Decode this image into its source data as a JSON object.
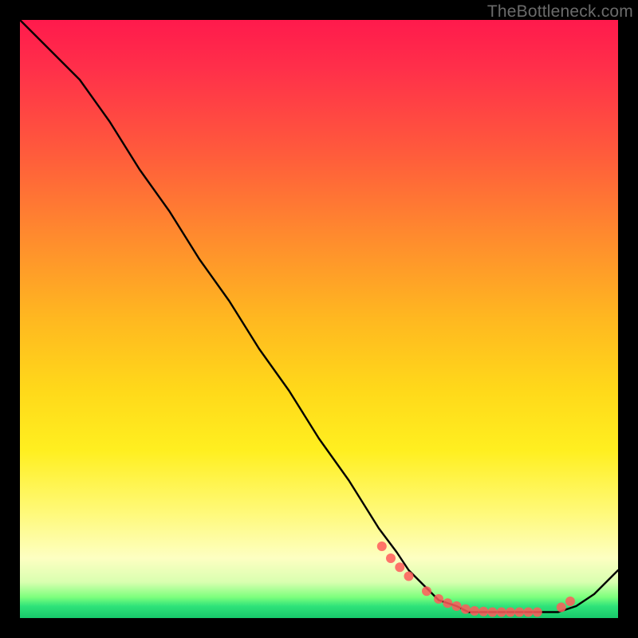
{
  "watermark": "TheBottleneck.com",
  "chart_data": {
    "type": "line",
    "title": "",
    "xlabel": "",
    "ylabel": "",
    "xlim": [
      0,
      100
    ],
    "ylim": [
      0,
      100
    ],
    "grid": false,
    "legend": false,
    "background_gradient": {
      "stops": [
        {
          "pos": 0,
          "color": "#ff1a4c"
        },
        {
          "pos": 50,
          "color": "#ffd91a"
        },
        {
          "pos": 90,
          "color": "#fdffc2"
        },
        {
          "pos": 100,
          "color": "#17c96b"
        }
      ]
    },
    "series": [
      {
        "name": "bottleneck-curve",
        "color": "#000000",
        "x": [
          0,
          3,
          6,
          10,
          15,
          20,
          25,
          30,
          35,
          40,
          45,
          50,
          55,
          60,
          63,
          65,
          68,
          70,
          73,
          75,
          78,
          80,
          82,
          84,
          86,
          88,
          90,
          93,
          96,
          100
        ],
        "y": [
          100,
          97,
          94,
          90,
          83,
          75,
          68,
          60,
          53,
          45,
          38,
          30,
          23,
          15,
          11,
          8,
          5,
          3,
          2,
          1,
          1,
          1,
          1,
          1,
          1,
          1,
          1,
          2,
          4,
          8
        ]
      }
    ],
    "markers": {
      "name": "highlight-dots",
      "color": "#ff5a5a",
      "radius_px": 6,
      "x": [
        60.5,
        62,
        63.5,
        65,
        68,
        70,
        71.5,
        73,
        74.5,
        76,
        77.5,
        79,
        80.5,
        82,
        83.5,
        85,
        86.5,
        90.5,
        92
      ],
      "y": [
        12,
        10,
        8.5,
        7,
        4.5,
        3.2,
        2.5,
        2,
        1.5,
        1.2,
        1.1,
        1,
        1,
        1,
        1,
        1,
        1,
        1.8,
        2.8
      ]
    }
  }
}
